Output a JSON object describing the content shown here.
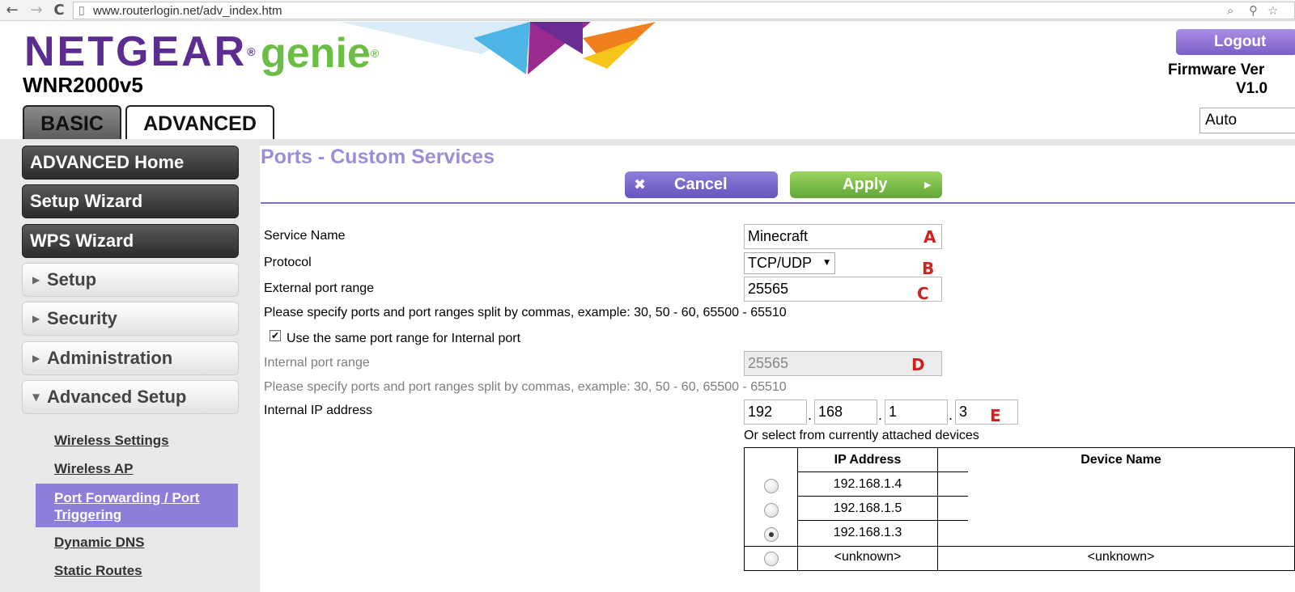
{
  "browser": {
    "url": "www.routerlogin.net/adv_index.htm",
    "back_icon": "←",
    "forward_icon": "→",
    "reload_icon": "C"
  },
  "header": {
    "brand": "NETGEAR",
    "brand_mark": "®",
    "product": "genie",
    "product_mark": "®",
    "model": "WNR2000v5",
    "logout_label": "Logout",
    "firmware_label": "Firmware Ver",
    "firmware_version": "V1.0",
    "language_value": "Auto",
    "colors": {
      "brand": "#5c2d91",
      "product": "#6bbd45",
      "accent": "#8d7fd9"
    }
  },
  "tabs": [
    {
      "label": "BASIC",
      "active": false
    },
    {
      "label": "ADVANCED",
      "active": true
    }
  ],
  "sidebar": {
    "main_items": [
      "ADVANCED Home",
      "Setup Wizard",
      "WPS Wizard"
    ],
    "sections": [
      {
        "label": "Setup",
        "expanded": false
      },
      {
        "label": "Security",
        "expanded": false
      },
      {
        "label": "Administration",
        "expanded": false
      },
      {
        "label": "Advanced Setup",
        "expanded": true
      }
    ],
    "sub_items": [
      "Wireless Settings",
      "Wireless AP",
      "Port Forwarding / Port Triggering",
      "Dynamic DNS",
      "Static Routes"
    ],
    "active_sub_item": "Port Forwarding / Port Triggering"
  },
  "main": {
    "title": "Ports - Custom Services",
    "cancel_label": "Cancel",
    "apply_label": "Apply",
    "form": {
      "service_name_label": "Service Name",
      "service_name_value": "Minecraft",
      "protocol_label": "Protocol",
      "protocol_value": "TCP/UDP",
      "external_port_label": "External port range",
      "external_port_value": "25565",
      "port_hint": "Please specify ports and port ranges split by commas, example: 30, 50 - 60, 65500 - 65510",
      "same_range_label": "Use the same port range for Internal port",
      "same_range_checked": true,
      "internal_port_label": "Internal port range",
      "internal_port_value": "25565",
      "internal_port_hint": "Please specify ports and port ranges split by commas, example: 30, 50 - 60, 65500 - 65510",
      "internal_ip_label": "Internal IP address",
      "ip_octets": [
        "192",
        "168",
        "1",
        "3"
      ],
      "select_devices_label": "Or select from currently attached devices"
    },
    "annotations": [
      "A",
      "B",
      "C",
      "D",
      "E"
    ],
    "device_table": {
      "headers": [
        "IP Address",
        "Device Name"
      ],
      "rows": [
        {
          "ip": "192.168.1.4",
          "name": "",
          "selected": false
        },
        {
          "ip": "192.168.1.5",
          "name": "",
          "selected": false
        },
        {
          "ip": "192.168.1.3",
          "name": "",
          "selected": true
        },
        {
          "ip": "<unknown>",
          "name": "<unknown>",
          "selected": false
        }
      ]
    }
  }
}
